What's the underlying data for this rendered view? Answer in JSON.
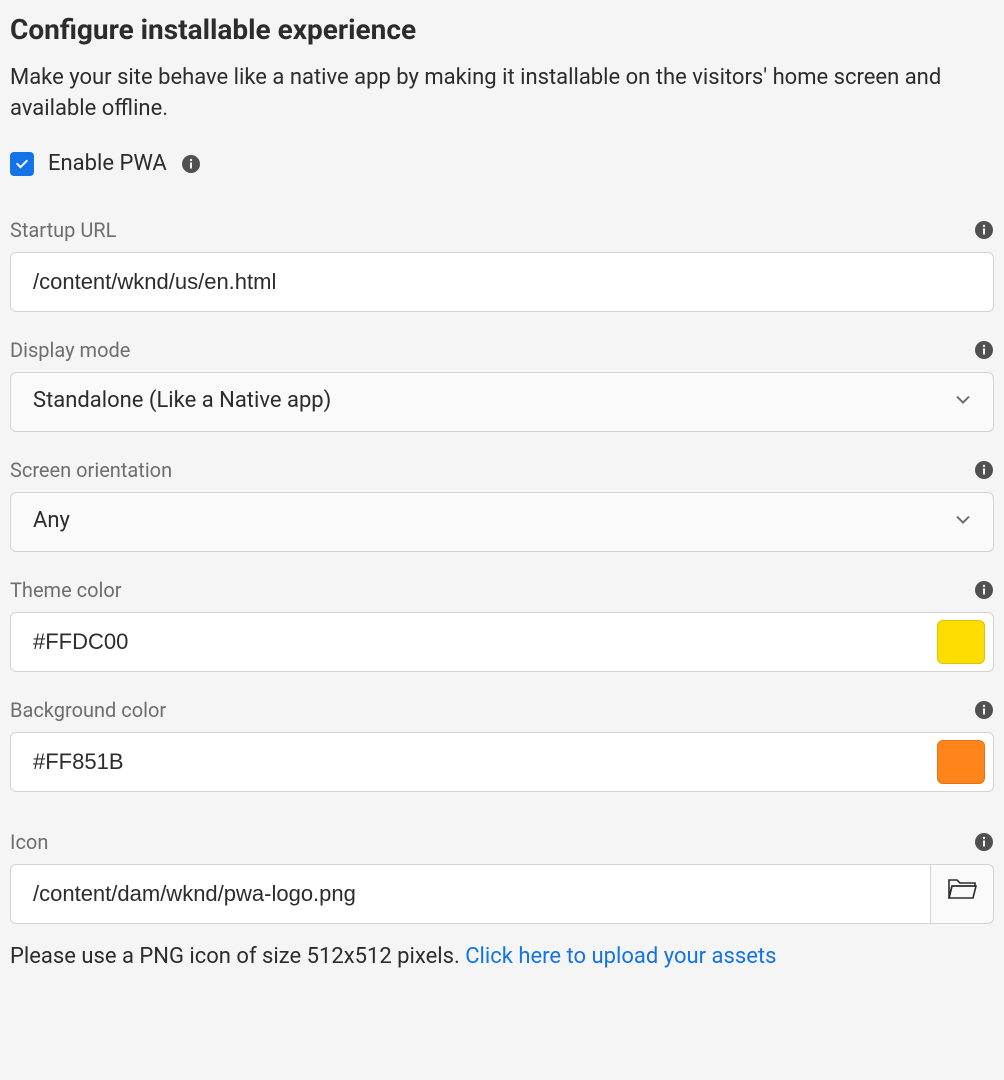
{
  "header": {
    "title": "Configure installable experience",
    "subtitle": "Make your site behave like a native app by making it installable on the visitors' home screen and available offline."
  },
  "enable": {
    "label": "Enable PWA",
    "checked": true
  },
  "fields": {
    "startup_url": {
      "label": "Startup URL",
      "value": "/content/wknd/us/en.html"
    },
    "display_mode": {
      "label": "Display mode",
      "value": "Standalone (Like a Native app)"
    },
    "screen_orientation": {
      "label": "Screen orientation",
      "value": "Any"
    },
    "theme_color": {
      "label": "Theme color",
      "value": "#FFDC00",
      "swatch": "#FFDC00"
    },
    "background_color": {
      "label": "Background color",
      "value": "#FF851B",
      "swatch": "#FF851B"
    },
    "icon": {
      "label": "Icon",
      "value": "/content/dam/wknd/pwa-logo.png"
    }
  },
  "footer": {
    "text": "Please use a PNG icon of size 512x512 pixels. ",
    "link": "Click here to upload your assets"
  }
}
